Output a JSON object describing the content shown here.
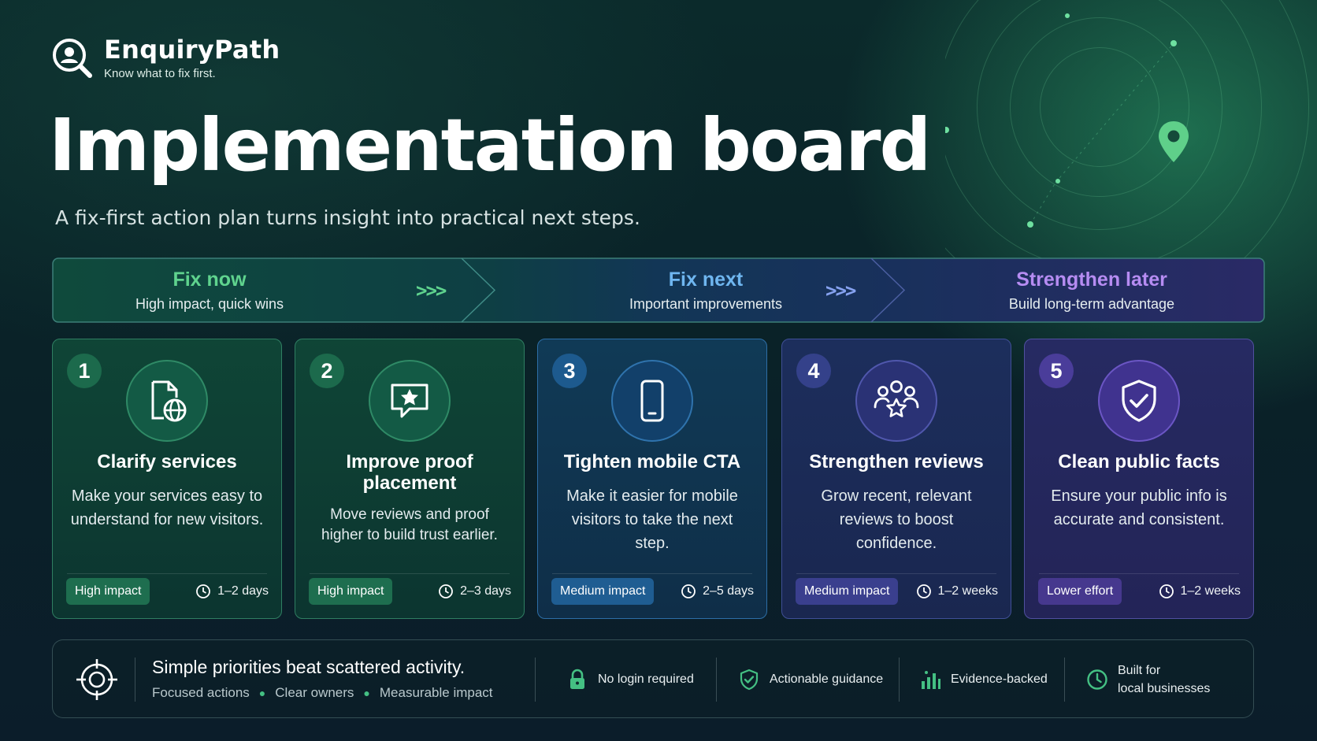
{
  "brand": {
    "name": "EnquiryPath",
    "tagline": "Know what to fix first."
  },
  "hero": {
    "title": "Implementation board",
    "subtitle": "A fix-first action plan turns insight into practical next steps."
  },
  "phases": [
    {
      "title": "Fix now",
      "subtitle": "High impact, quick wins",
      "color": "#5fd38e"
    },
    {
      "title": "Fix next",
      "subtitle": "Important improvements",
      "color": "#6fb6f0"
    },
    {
      "title": "Strengthen later",
      "subtitle": "Build long-term advantage",
      "color": "#b68cf2"
    }
  ],
  "phase_separator": ">>>",
  "cards": [
    {
      "number": "1",
      "title": "Clarify services",
      "description": "Make your services easy to understand for new visitors.",
      "badge": "High impact",
      "duration": "1–2 days",
      "icon": "web-page-globe-icon"
    },
    {
      "number": "2",
      "title": "Improve proof placement",
      "description": "Move reviews and proof higher to build trust earlier.",
      "badge": "High impact",
      "duration": "2–3 days",
      "icon": "star-review-bubble-icon"
    },
    {
      "number": "3",
      "title": "Tighten mobile CTA",
      "description": "Make it easier for mobile visitors to take the next step.",
      "badge": "Medium impact",
      "duration": "2–5 days",
      "icon": "mobile-phone-icon"
    },
    {
      "number": "4",
      "title": "Strengthen reviews",
      "description": "Grow recent, relevant reviews to boost confidence.",
      "badge": "Medium impact",
      "duration": "1–2 weeks",
      "icon": "people-star-icon"
    },
    {
      "number": "5",
      "title": "Clean public facts",
      "description": "Ensure your public info is accurate and consistent.",
      "badge": "Lower effort",
      "duration": "1–2 weeks",
      "icon": "shield-check-icon"
    }
  ],
  "footer": {
    "headline": "Simple priorities beat scattered activity.",
    "points": [
      "Focused actions",
      "Clear owners",
      "Measurable impact"
    ],
    "features": [
      {
        "label": "No login required",
        "icon": "lock-icon"
      },
      {
        "label": "Actionable guidance",
        "icon": "shield-check-icon"
      },
      {
        "label": "Evidence-backed",
        "icon": "bar-chart-icon"
      },
      {
        "label_line1": "Built for",
        "label_line2": "local businesses",
        "icon": "clock-icon"
      }
    ]
  },
  "colors": {
    "green_accent": "#44c083",
    "blue_accent": "#3f8fd6",
    "purple_accent": "#8a6ae0"
  }
}
